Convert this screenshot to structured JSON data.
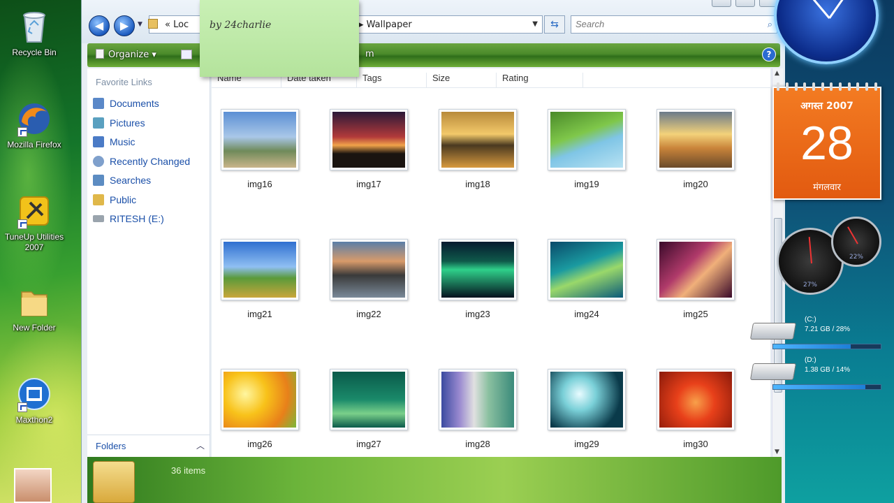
{
  "desktop": {
    "icons": [
      {
        "label": "Recycle Bin",
        "icon": "recycle-bin-icon"
      },
      {
        "label": "Mozilla Firefox",
        "icon": "firefox-icon"
      },
      {
        "label": "TuneUp Utilities 2007",
        "icon": "tuneup-icon"
      },
      {
        "label": "New Folder",
        "icon": "folder-icon"
      },
      {
        "label": "Maxthon2",
        "icon": "maxthon-icon"
      }
    ]
  },
  "explorer": {
    "address": {
      "left_crumb": "« Loc",
      "right_crumb": "▸ Wallpaper"
    },
    "search_placeholder": "Search",
    "command_bar": {
      "organize": "Organize ▾",
      "slideshow_fragment": "m"
    },
    "nav_pane": {
      "title": "Favorite Links",
      "links": [
        {
          "label": "Documents",
          "icon": "documents-icon",
          "color": "#5a88c8"
        },
        {
          "label": "Pictures",
          "icon": "pictures-icon",
          "color": "#5aa0c0"
        },
        {
          "label": "Music",
          "icon": "music-icon",
          "color": "#4b7bc6"
        },
        {
          "label": "Recently Changed",
          "icon": "recent-icon",
          "color": "#7fa0cc"
        },
        {
          "label": "Searches",
          "icon": "searches-icon",
          "color": "#5c8cc2"
        },
        {
          "label": "Public",
          "icon": "public-folder-icon",
          "color": "#e0b84a"
        },
        {
          "label": "RITESH (E:)",
          "icon": "drive-icon",
          "color": "#9aa4ad"
        }
      ],
      "folders_label": "Folders"
    },
    "columns": [
      "Name",
      "Date taken",
      "Tags",
      "Size",
      "Rating"
    ],
    "thumbnails": [
      {
        "caption": "img16",
        "bg": "linear-gradient(180deg,#5b8fd4 0%,#a9c7e8 45%,#6f8a5a 70%,#c9b48a 100%)"
      },
      {
        "caption": "img17",
        "bg": "linear-gradient(180deg,#2b1838 0%,#b23a3a 45%,#f1a34a 60%,#1a1410 75%)"
      },
      {
        "caption": "img18",
        "bg": "linear-gradient(180deg,#b88a3a 0%,#f3c96a 40%,#4a3a20 60%,#d79a3e 100%)"
      },
      {
        "caption": "img19",
        "bg": "linear-gradient(160deg,#4a8a2a 0%,#7fc74a 40%,#7fc5e6 60%,#b8e2f2 100%)"
      },
      {
        "caption": "img20",
        "bg": "linear-gradient(180deg,#6a7a8a 0%,#f3d27a 40%,#c9843a 65%,#6a4a2a 100%)"
      },
      {
        "caption": "img21",
        "bg": "linear-gradient(180deg,#2f6fd0 0%,#8fbff2 45%,#5a9a3a 65%,#c9a63a 100%)"
      },
      {
        "caption": "img22",
        "bg": "linear-gradient(180deg,#5a7ea8 0%,#d89a6a 35%,#3a3a3a 60%,#7a8a9a 100%)"
      },
      {
        "caption": "img23",
        "bg": "linear-gradient(180deg,#061a2e 0%,#0f5a4a 35%,#2fd08a 50%,#05121e 100%)"
      },
      {
        "caption": "img24",
        "bg": "linear-gradient(160deg,#0a4a6a 0%,#1a9aa0 40%,#9ad86a 60%,#0a5a7a 100%)"
      },
      {
        "caption": "img25",
        "bg": "linear-gradient(135deg,#3a0a2a 0%,#b03a6a 40%,#f0b07a 60%,#3a0a2a 100%)"
      },
      {
        "caption": "img26",
        "bg": "radial-gradient(circle at 30% 40%,#fff6a0 0%,#f8c21a 35%,#e8801a 70%,#7ab83a 100%)"
      },
      {
        "caption": "img27",
        "bg": "linear-gradient(180deg,#0a5a4a 0%,#1a8a6a 50%,#7ad08a 75%,#0a5a4a 100%)"
      },
      {
        "caption": "img28",
        "bg": "linear-gradient(90deg,#3a4aa0 0%,#9a8ad0 25%,#e0e0e0 45%,#8ac0a0 65%,#3a8a7a 100%)"
      },
      {
        "caption": "img29",
        "bg": "radial-gradient(circle at 40% 40%,#e8fbff 0%,#7ad0d8 30%,#0a3a4a 75%)"
      },
      {
        "caption": "img30",
        "bg": "radial-gradient(circle at 50% 55%,#f8a04a 0%,#e8401a 40%,#8a1a0a 100%)"
      }
    ],
    "details": {
      "item_count": "36 items"
    }
  },
  "sticky_note": {
    "text": "by 24charlie"
  },
  "gadgets": {
    "calendar": {
      "month": "अगस्त 2007",
      "day": "28",
      "weekday": "मंगलवार"
    },
    "cpu_meter": {
      "cpu": "27%",
      "ram": "22%"
    },
    "drives": [
      {
        "label": "(C:)",
        "stat": "7.21 GB / 28%",
        "fill": 0.72
      },
      {
        "label": "(D:)",
        "stat": "1.38 GB / 14%",
        "fill": 0.86
      }
    ]
  },
  "colors": {
    "accent_green": "#4a8a2a",
    "link_blue": "#1a4fa8",
    "calendar_orange": "#e25a10"
  }
}
